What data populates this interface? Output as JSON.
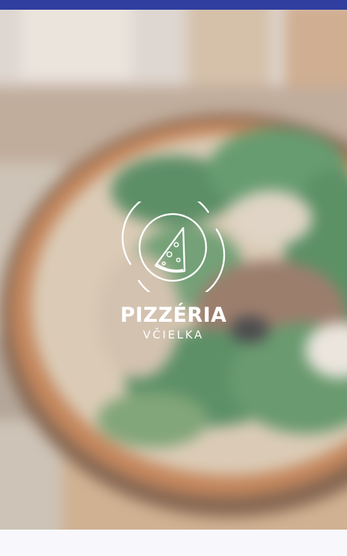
{
  "brand": {
    "title": "PIZZÉRIA",
    "subtitle": "VČIELKA",
    "logo_icon": "pizza-slice-icon"
  },
  "background": {
    "description_icon": "blurred-pizza-photo"
  },
  "colors": {
    "status_bar": "#303f9f",
    "logo": "#ffffff",
    "bottom_bar": "#f8f8fc"
  }
}
